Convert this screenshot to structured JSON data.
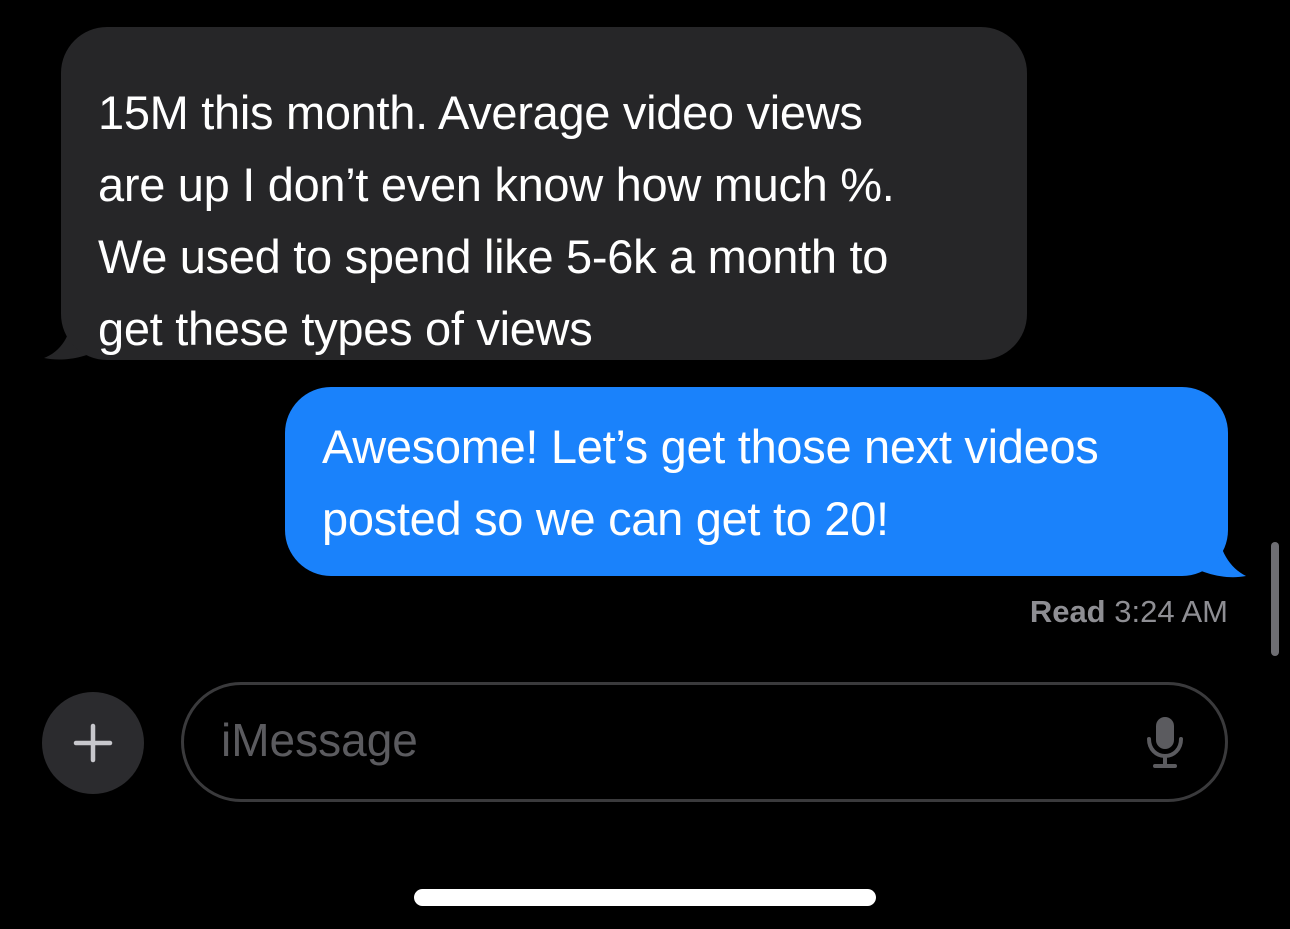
{
  "conversation": {
    "incoming": {
      "lines": [
        "15M this month. Average video views",
        "are up I don’t even know how much %.",
        "We used to spend like 5-6k a month to",
        "get these types of views"
      ],
      "color": "#262628"
    },
    "outgoing": {
      "lines": [
        "Awesome! Let’s get those next videos",
        "posted so we can get to 20!"
      ],
      "color": "#1a82fb"
    },
    "receipt": {
      "label": "Read",
      "time": "3:24 AM"
    }
  },
  "composer": {
    "add_icon": "plus-icon",
    "placeholder": "iMessage",
    "mic_icon": "microphone-icon"
  }
}
